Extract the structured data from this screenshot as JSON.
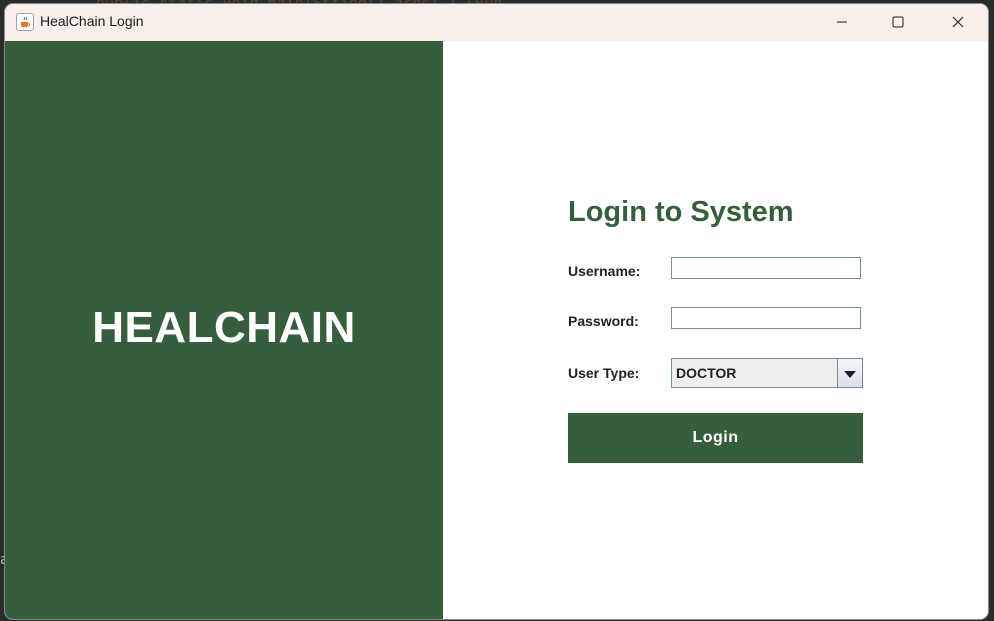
{
  "window": {
    "title": "HealChain Login"
  },
  "background": {
    "code_fragment": "public static void main(String[] args) { &Run",
    "gutter_char": "a"
  },
  "left_panel": {
    "brand": "HEALCHAIN"
  },
  "form": {
    "title": "Login to System",
    "username_label": "Username:",
    "username_value": "",
    "password_label": "Password:",
    "password_value": "",
    "user_type_label": "User Type:",
    "user_type_value": "DOCTOR",
    "login_label": "Login"
  },
  "colors": {
    "brand_green": "#365e3c",
    "white": "#ffffff"
  },
  "icons": {
    "app": "java-cup-icon",
    "minimize": "minimize-icon",
    "maximize": "maximize-icon",
    "close": "close-icon",
    "dropdown": "chevron-down-icon"
  }
}
